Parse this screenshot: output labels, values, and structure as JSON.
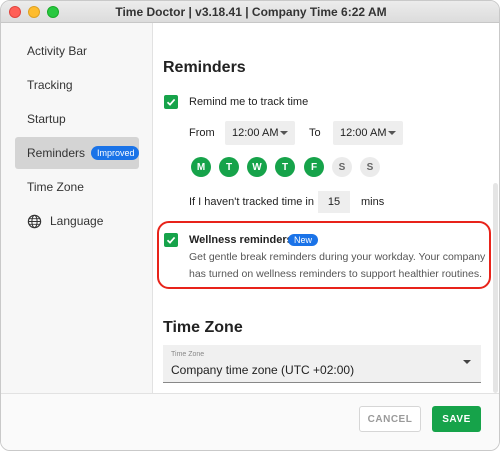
{
  "window": {
    "title": "Time Doctor | v3.18.41 | Company Time 6:22 AM"
  },
  "sidebar": {
    "items": [
      {
        "label": "Activity Bar"
      },
      {
        "label": "Tracking"
      },
      {
        "label": "Startup"
      },
      {
        "label": "Reminders",
        "badge": "Improved"
      },
      {
        "label": "Time Zone"
      },
      {
        "label": "Language",
        "icon": "globe-icon"
      }
    ]
  },
  "reminders": {
    "heading": "Reminders",
    "track_label": "Remind me to track time",
    "from_label": "From",
    "from_value": "12:00 AM",
    "to_label": "To",
    "to_value": "12:00 AM",
    "days": [
      {
        "letter": "M",
        "on": true
      },
      {
        "letter": "T",
        "on": true
      },
      {
        "letter": "W",
        "on": true
      },
      {
        "letter": "T",
        "on": true
      },
      {
        "letter": "F",
        "on": true
      },
      {
        "letter": "S",
        "on": false
      },
      {
        "letter": "S",
        "on": false
      }
    ],
    "idle_label": "If I haven't tracked time in",
    "idle_value": "15",
    "idle_unit": "mins",
    "wellness_title": "Wellness reminders",
    "wellness_badge": "New",
    "wellness_desc": "Get gentle break reminders during your workday. Your company has turned on wellness reminders to support healthier routines."
  },
  "timezone": {
    "heading": "Time Zone",
    "field_label": "Time Zone",
    "value": "Company time zone (UTC +02:00)"
  },
  "footer": {
    "cancel_label": "CANCEL",
    "save_label": "SAVE"
  },
  "colors": {
    "accent_green": "#16a34a",
    "badge_blue": "#1a73e8",
    "highlight_red": "#e8231a"
  }
}
